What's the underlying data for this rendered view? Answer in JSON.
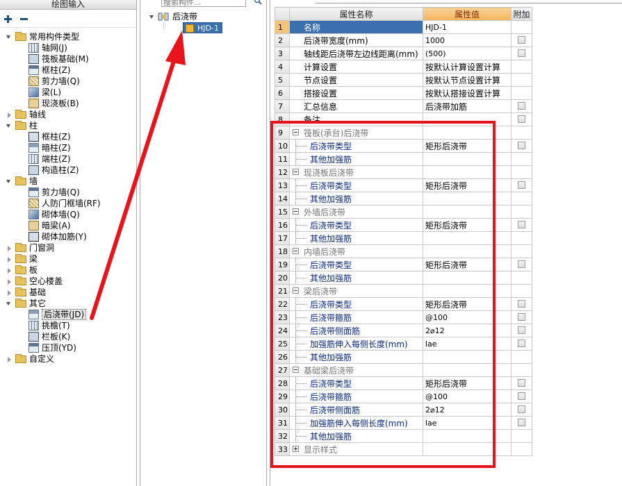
{
  "left_panel": {
    "title": "绘图输入",
    "tree": [
      {
        "label": "常用构件类型",
        "type": "folder",
        "expanded": true
      },
      {
        "label": "轴网(J)",
        "type": "item"
      },
      {
        "label": "筏板基础(M)",
        "type": "item"
      },
      {
        "label": "框柱(Z)",
        "type": "item"
      },
      {
        "label": "剪力墙(Q)",
        "type": "item"
      },
      {
        "label": "梁(L)",
        "type": "item"
      },
      {
        "label": "现浇板(B)",
        "type": "item"
      },
      {
        "label": "轴线",
        "type": "folder",
        "expanded": false
      },
      {
        "label": "柱",
        "type": "folder",
        "expanded": true
      },
      {
        "label": "框柱(Z)",
        "type": "item"
      },
      {
        "label": "暗柱(Z)",
        "type": "item"
      },
      {
        "label": "端柱(Z)",
        "type": "item"
      },
      {
        "label": "构造柱(Z)",
        "type": "item"
      },
      {
        "label": "墙",
        "type": "folder",
        "expanded": true
      },
      {
        "label": "剪力墙(Q)",
        "type": "item"
      },
      {
        "label": "人防门框墙(RF)",
        "type": "item"
      },
      {
        "label": "砌体墙(Q)",
        "type": "item"
      },
      {
        "label": "暗梁(A)",
        "type": "item"
      },
      {
        "label": "砌体加筋(Y)",
        "type": "item"
      },
      {
        "label": "门窗洞",
        "type": "folder",
        "expanded": false
      },
      {
        "label": "梁",
        "type": "folder",
        "expanded": false
      },
      {
        "label": "板",
        "type": "folder",
        "expanded": false
      },
      {
        "label": "空心楼盖",
        "type": "folder",
        "expanded": false
      },
      {
        "label": "基础",
        "type": "folder",
        "expanded": false
      },
      {
        "label": "其它",
        "type": "folder",
        "expanded": true
      },
      {
        "label": "后浇带(JD)",
        "type": "item",
        "selected": true
      },
      {
        "label": "挑檐(T)",
        "type": "item"
      },
      {
        "label": "栏板(K)",
        "type": "item"
      },
      {
        "label": "压顶(YD)",
        "type": "item"
      },
      {
        "label": "自定义",
        "type": "folder",
        "expanded": false
      }
    ]
  },
  "middle_panel": {
    "search_placeholder": "搜索构件...",
    "root_label": "后浇带",
    "selected_component": "HJD-1"
  },
  "property_grid": {
    "headers": {
      "num": "",
      "name": "属性名称",
      "value": "属性值",
      "add": "附加"
    },
    "rows": [
      {
        "n": "1",
        "name": "名称",
        "value": "HJD-1",
        "check": false,
        "kind": "selected"
      },
      {
        "n": "2",
        "name": "后浇带宽度(mm)",
        "value": "1000",
        "check": true,
        "kind": "normal"
      },
      {
        "n": "3",
        "name": "轴线距后浇带左边线距离(mm)",
        "value": "(500)",
        "check": true,
        "kind": "normal"
      },
      {
        "n": "4",
        "name": "计算设置",
        "value": "按默认计算设置计算",
        "check": false,
        "kind": "normal"
      },
      {
        "n": "5",
        "name": "节点设置",
        "value": "按默认节点设置计算",
        "check": false,
        "kind": "normal"
      },
      {
        "n": "6",
        "name": "搭接设置",
        "value": "按默认搭接设置计算",
        "check": false,
        "kind": "normal"
      },
      {
        "n": "7",
        "name": "汇总信息",
        "value": "后浇带加筋",
        "check": true,
        "kind": "normal"
      },
      {
        "n": "8",
        "name": "备注",
        "value": "",
        "check": true,
        "kind": "normal"
      },
      {
        "n": "9",
        "name": "筏板(承台)后浇带",
        "value": "",
        "check": false,
        "kind": "group"
      },
      {
        "n": "10",
        "name": "后浇带类型",
        "value": "矩形后浇带",
        "check": true,
        "kind": "child"
      },
      {
        "n": "11",
        "name": "其他加强筋",
        "value": "",
        "check": false,
        "kind": "child"
      },
      {
        "n": "12",
        "name": "现浇板后浇带",
        "value": "",
        "check": false,
        "kind": "group"
      },
      {
        "n": "13",
        "name": "后浇带类型",
        "value": "矩形后浇带",
        "check": true,
        "kind": "child"
      },
      {
        "n": "14",
        "name": "其他加强筋",
        "value": "",
        "check": false,
        "kind": "child"
      },
      {
        "n": "15",
        "name": "外墙后浇带",
        "value": "",
        "check": false,
        "kind": "group"
      },
      {
        "n": "16",
        "name": "后浇带类型",
        "value": "矩形后浇带",
        "check": true,
        "kind": "child"
      },
      {
        "n": "17",
        "name": "其他加强筋",
        "value": "",
        "check": false,
        "kind": "child"
      },
      {
        "n": "18",
        "name": "内墙后浇带",
        "value": "",
        "check": false,
        "kind": "group"
      },
      {
        "n": "19",
        "name": "后浇带类型",
        "value": "矩形后浇带",
        "check": true,
        "kind": "child"
      },
      {
        "n": "20",
        "name": "其他加强筋",
        "value": "",
        "check": false,
        "kind": "child"
      },
      {
        "n": "21",
        "name": "梁后浇带",
        "value": "",
        "check": false,
        "kind": "group"
      },
      {
        "n": "22",
        "name": "后浇带类型",
        "value": "矩形后浇带",
        "check": true,
        "kind": "child"
      },
      {
        "n": "23",
        "name": "后浇带箍筋",
        "value": "@100",
        "check": true,
        "kind": "child"
      },
      {
        "n": "24",
        "name": "后浇带侧面筋",
        "value": "2⌀12",
        "check": true,
        "kind": "child"
      },
      {
        "n": "25",
        "name": "加强筋伸入每侧长度(mm)",
        "value": "lae",
        "check": true,
        "kind": "child"
      },
      {
        "n": "26",
        "name": "其他加强筋",
        "value": "",
        "check": false,
        "kind": "child"
      },
      {
        "n": "27",
        "name": "基础梁后浇带",
        "value": "",
        "check": false,
        "kind": "group"
      },
      {
        "n": "28",
        "name": "后浇带类型",
        "value": "矩形后浇带",
        "check": true,
        "kind": "child"
      },
      {
        "n": "29",
        "name": "后浇带箍筋",
        "value": "@100",
        "check": true,
        "kind": "child"
      },
      {
        "n": "30",
        "name": "后浇带侧面筋",
        "value": "2⌀12",
        "check": true,
        "kind": "child"
      },
      {
        "n": "31",
        "name": "加强筋伸入每侧长度(mm)",
        "value": "lae",
        "check": true,
        "kind": "child"
      },
      {
        "n": "32",
        "name": "其他加强筋",
        "value": "",
        "check": false,
        "kind": "child"
      },
      {
        "n": "33",
        "name": "显示样式",
        "value": "",
        "check": false,
        "kind": "group-collapsed"
      }
    ]
  },
  "colors": {
    "annotation_red": "#e8141b",
    "selection_blue": "#3a6fb0",
    "header_value_orange": "#f3b35b"
  }
}
